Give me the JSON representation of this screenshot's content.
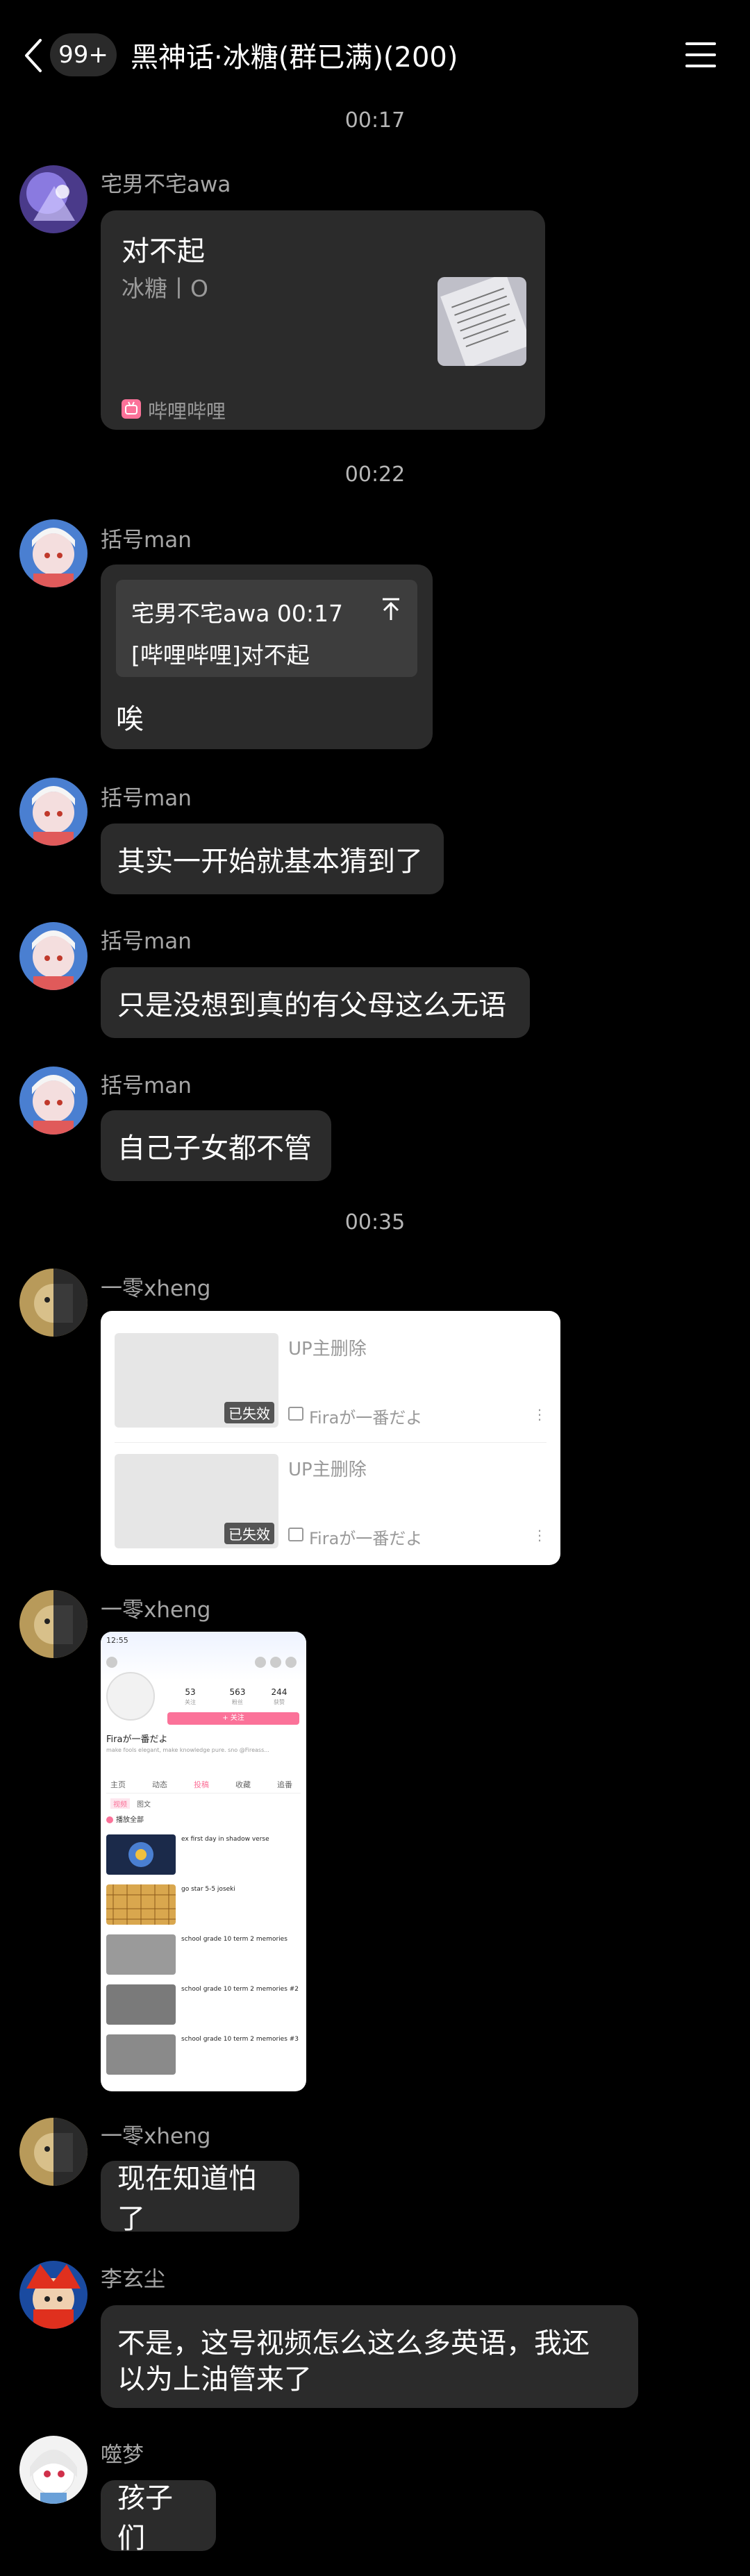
{
  "header": {
    "unread": "99+",
    "title": "黑神话·冰糖(群已满)(200)"
  },
  "times": [
    "00:17",
    "00:22",
    "00:35"
  ],
  "messages": [
    {
      "sender": "宅男不宅awa",
      "card_title": "对不起",
      "card_sub": "冰糖丨O",
      "card_source": "哔哩哔哩"
    },
    {
      "sender": "括号man",
      "quote_header": "宅男不宅awa 00:17",
      "quote_text": "[哔哩哔哩]对不起",
      "text": "唉"
    },
    {
      "sender": "括号man",
      "text": "其实一开始就基本猜到了"
    },
    {
      "sender": "括号man",
      "text": "只是没想到真的有父母这么无语"
    },
    {
      "sender": "括号man",
      "text": "自己子女都不管"
    },
    {
      "sender": "一零xheng",
      "videos": [
        {
          "status": "已失效",
          "title": "UP主删除",
          "author": "Firaが一番だよ"
        },
        {
          "status": "已失效",
          "title": "UP主删除",
          "author": "Firaが一番だよ"
        }
      ]
    },
    {
      "sender": "一零xheng",
      "screenshot": {
        "time": "12:55",
        "stats": [
          {
            "n": "53",
            "l": "关注"
          },
          {
            "n": "563",
            "l": "粉丝"
          },
          {
            "n": "244",
            "l": "获赞"
          }
        ],
        "follow": "+ 关注",
        "username": "Firaが一番だよ",
        "bio": "make fools elegant, make knowledge pure. sno @Fireass...",
        "tabs": [
          "主页",
          "动态",
          "投稿",
          "收藏",
          "追番"
        ],
        "subtabs": [
          "视频",
          "图文"
        ],
        "play_all": "播放全部",
        "videos": [
          "ex first day in shadow verse",
          "go star 5-5 joseki",
          "school grade 10 term 2 memories",
          "school grade 10 term 2 memories #2",
          "school grade 10 term 2 memories #3"
        ]
      }
    },
    {
      "sender": "一零xheng",
      "text": "现在知道怕了"
    },
    {
      "sender": "李玄尘",
      "text_line1": "不是，这号视频怎么这么多英语，我还",
      "text_line2": "以为上油管来了"
    },
    {
      "sender": "噬梦",
      "text": "孩子们"
    }
  ],
  "colors": {
    "bubble": "#2b2b2b",
    "background": "#000000",
    "bilibili_pink": "#fb7299"
  }
}
